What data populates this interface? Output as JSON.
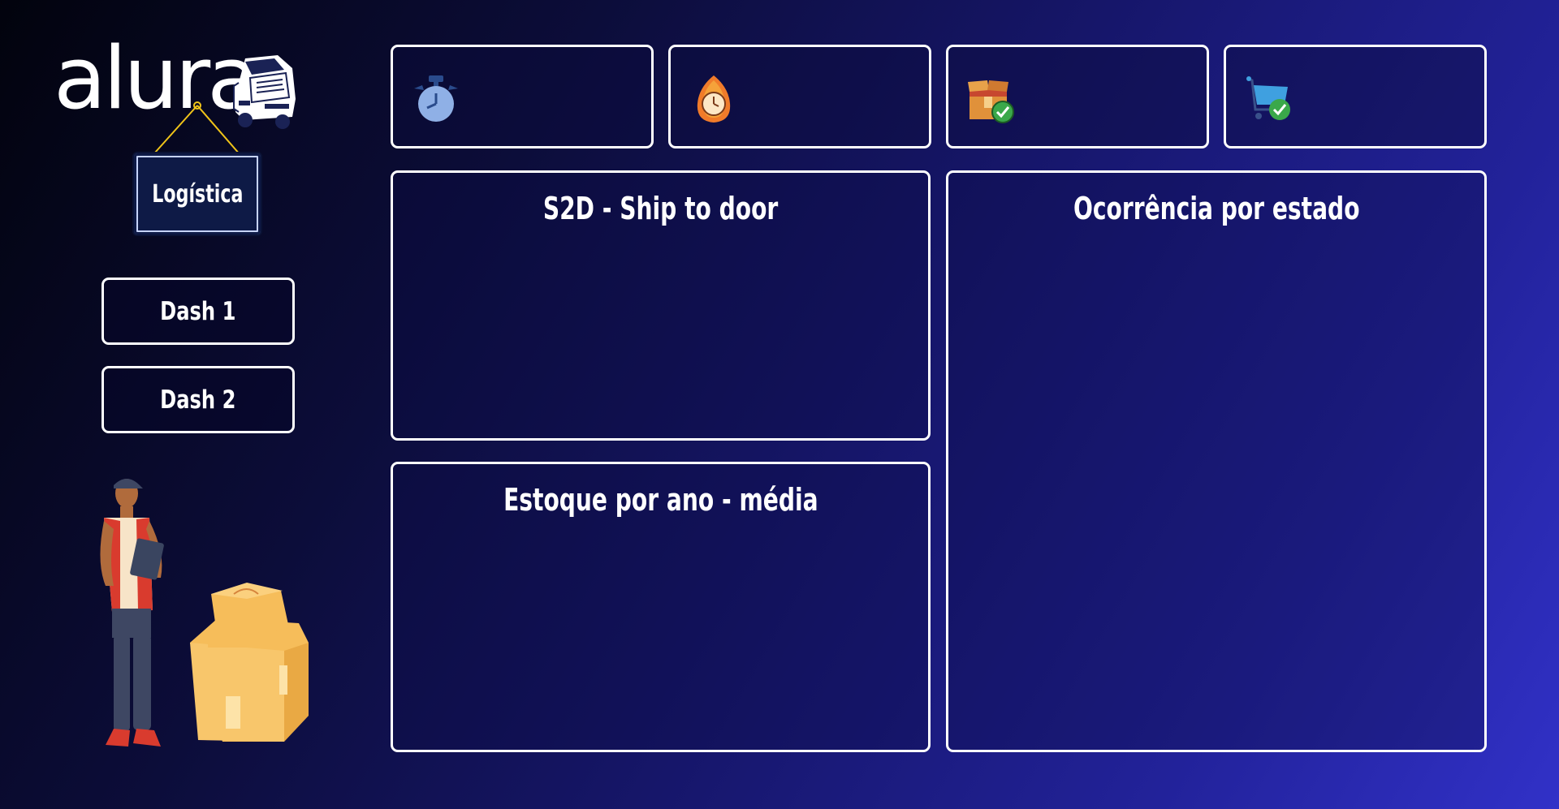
{
  "brand": {
    "logo_text": "alura",
    "sign_label": "Logística"
  },
  "nav": {
    "items": [
      {
        "label": "Dash 1"
      },
      {
        "label": "Dash 2"
      }
    ]
  },
  "kpis": [
    {
      "icon": "stopwatch-icon"
    },
    {
      "icon": "fire-clock-icon"
    },
    {
      "icon": "box-check-icon"
    },
    {
      "icon": "cart-check-icon"
    }
  ],
  "panels": {
    "s2d": {
      "title": "S2D - Ship to door"
    },
    "estoque": {
      "title": "Estoque por ano - média"
    },
    "ocorrencia": {
      "title": "Ocorrência por estado"
    }
  },
  "colors": {
    "background_start": "#02030d",
    "background_end": "#3131c8",
    "border": "#ffffff",
    "sign_bg": "#0e1a46",
    "box_color": "#f6bd5a",
    "check_green": "#3aa84a"
  }
}
